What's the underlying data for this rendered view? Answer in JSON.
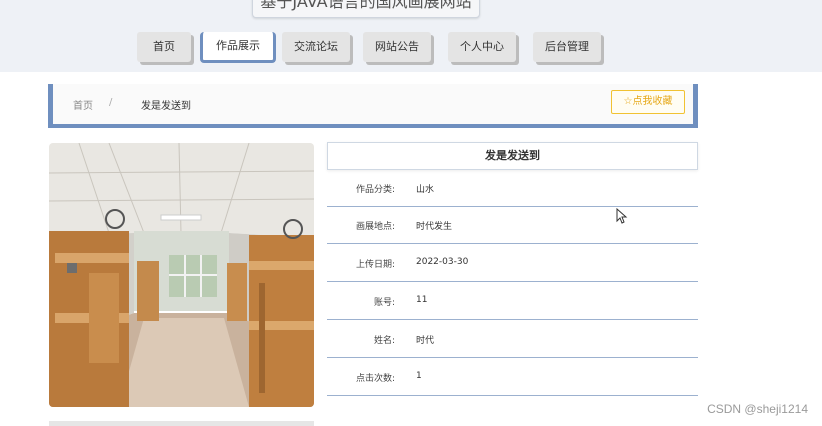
{
  "header": {
    "site_title": "基于JAVA语言的国风画展网站"
  },
  "nav": {
    "items": [
      {
        "label": "首页",
        "active": false
      },
      {
        "label": "作品展示",
        "active": true
      },
      {
        "label": "交流论坛",
        "active": false
      },
      {
        "label": "网站公告",
        "active": false
      },
      {
        "label": "个人中心",
        "active": false
      },
      {
        "label": "后台管理",
        "active": false
      }
    ]
  },
  "breadcrumb": {
    "home": "首页",
    "separator": "/",
    "current": "发是发送到"
  },
  "favorite_button": {
    "icon": "star-outline-icon",
    "label": "☆点我收藏"
  },
  "artwork": {
    "title": "发是发送到",
    "image_alt": "dormitory-room-photo",
    "fields": [
      {
        "label": "作品分类:",
        "value": "山水"
      },
      {
        "label": "画展地点:",
        "value": "时代发生"
      },
      {
        "label": "上传日期:",
        "value": "2022-03-30"
      },
      {
        "label": "账号:",
        "value": "11"
      },
      {
        "label": "姓名:",
        "value": "时代"
      },
      {
        "label": "点击次数:",
        "value": "1"
      }
    ]
  },
  "watermark": "CSDN @sheji1214",
  "colors": {
    "accent": "#6f8fbf",
    "favorite": "#e6a817",
    "header_bg": "#eef1f6"
  }
}
